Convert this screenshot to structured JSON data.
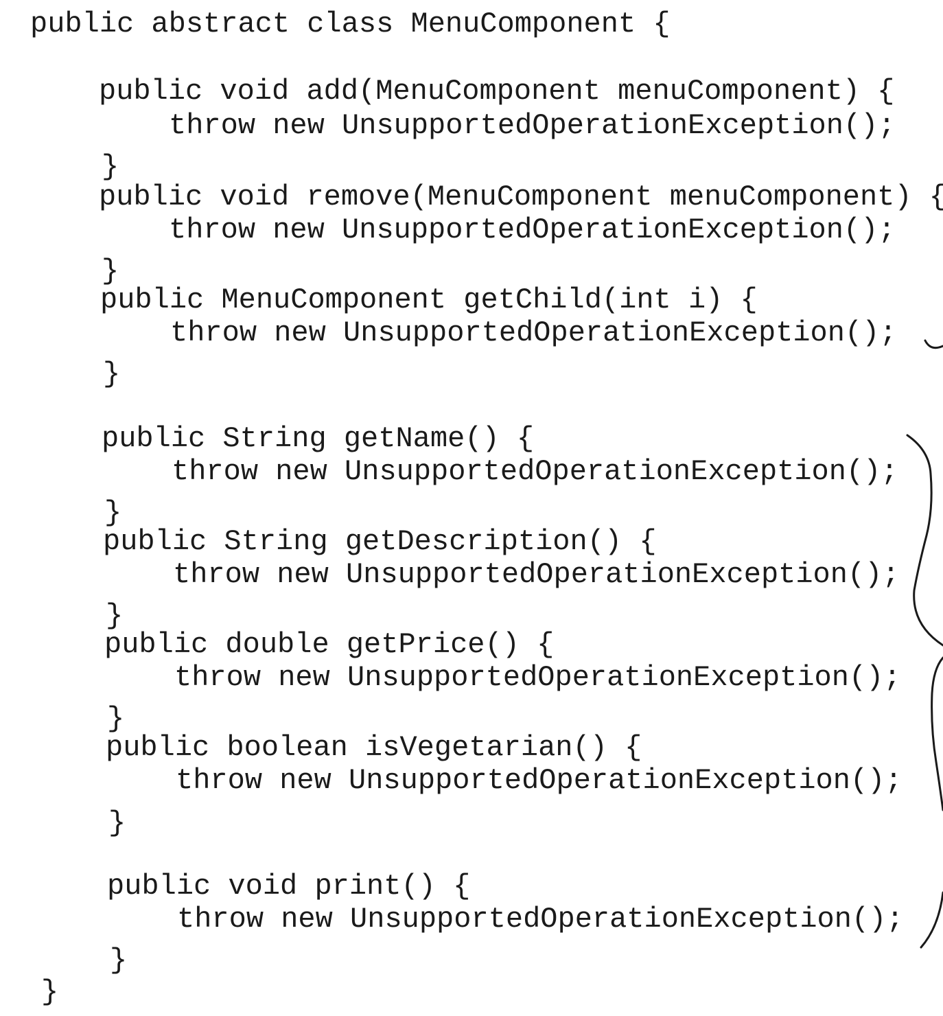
{
  "code": {
    "lines": [
      "public abstract class MenuComponent {",
      "public void add(MenuComponent menuComponent) {",
      "throw new UnsupportedOperationException();",
      "}",
      "public void remove(MenuComponent menuComponent) {",
      "throw new UnsupportedOperationException();",
      "}",
      "public MenuComponent getChild(int i) {",
      "throw new UnsupportedOperationException();",
      "}",
      "public String getName() {",
      "throw new UnsupportedOperationException();",
      "}",
      "public String getDescription() {",
      "throw new UnsupportedOperationException();",
      "}",
      "public double getPrice() {",
      "throw new UnsupportedOperationException();",
      "}",
      "public boolean isVegetarian() {",
      "throw new UnsupportedOperationException();",
      "}",
      "public void print() {",
      "throw new UnsupportedOperationException();",
      "}",
      "}"
    ]
  }
}
